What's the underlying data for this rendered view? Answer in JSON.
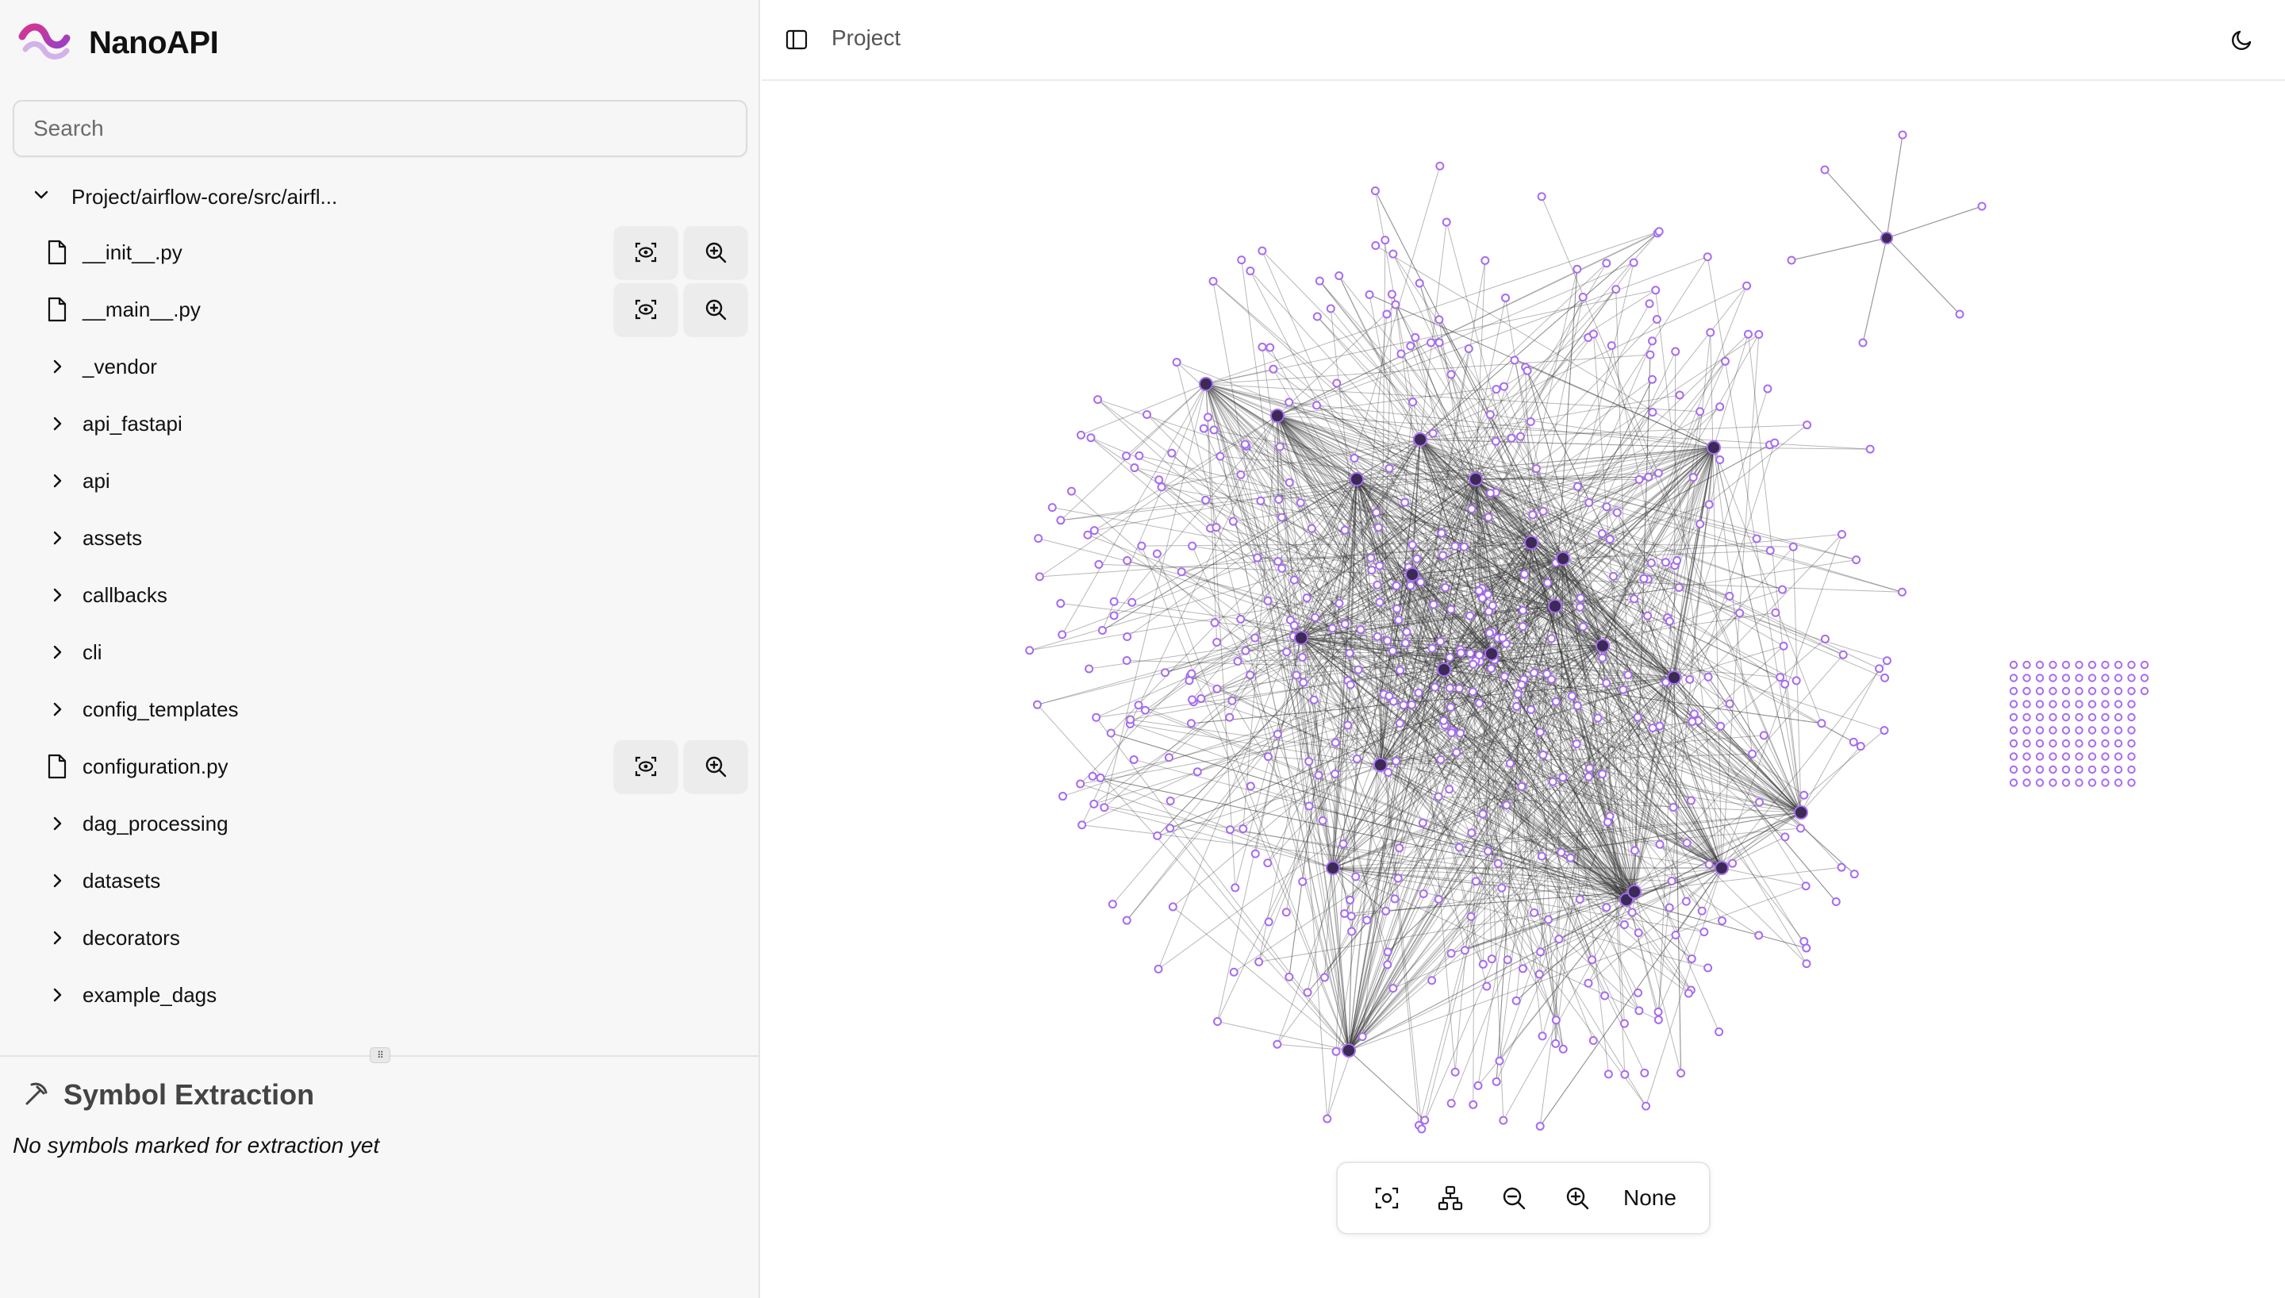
{
  "brand": {
    "name": "NanoAPI",
    "logo_icon": "nanoapi-wave-logo",
    "accent": "#c03c9a"
  },
  "search": {
    "placeholder": "Search"
  },
  "tree": {
    "root_label": "Project/airflow-core/src/airfl...",
    "items": [
      {
        "label": "__init__.py",
        "kind": "file"
      },
      {
        "label": "__main__.py",
        "kind": "file"
      },
      {
        "label": "_vendor",
        "kind": "folder"
      },
      {
        "label": "api_fastapi",
        "kind": "folder"
      },
      {
        "label": "api",
        "kind": "folder"
      },
      {
        "label": "assets",
        "kind": "folder"
      },
      {
        "label": "callbacks",
        "kind": "folder"
      },
      {
        "label": "cli",
        "kind": "folder"
      },
      {
        "label": "config_templates",
        "kind": "folder"
      },
      {
        "label": "configuration.py",
        "kind": "file"
      },
      {
        "label": "dag_processing",
        "kind": "folder"
      },
      {
        "label": "datasets",
        "kind": "folder"
      },
      {
        "label": "decorators",
        "kind": "folder"
      },
      {
        "label": "example_dags",
        "kind": "folder"
      }
    ]
  },
  "symbol_extraction": {
    "title": "Symbol Extraction",
    "empty_text": "No symbols marked for extraction yet"
  },
  "header": {
    "breadcrumb": "Project"
  },
  "graph": {
    "node_color": "#a66cf0",
    "edge_color": "#333333"
  },
  "toolbar": {
    "layout_label": "None"
  }
}
